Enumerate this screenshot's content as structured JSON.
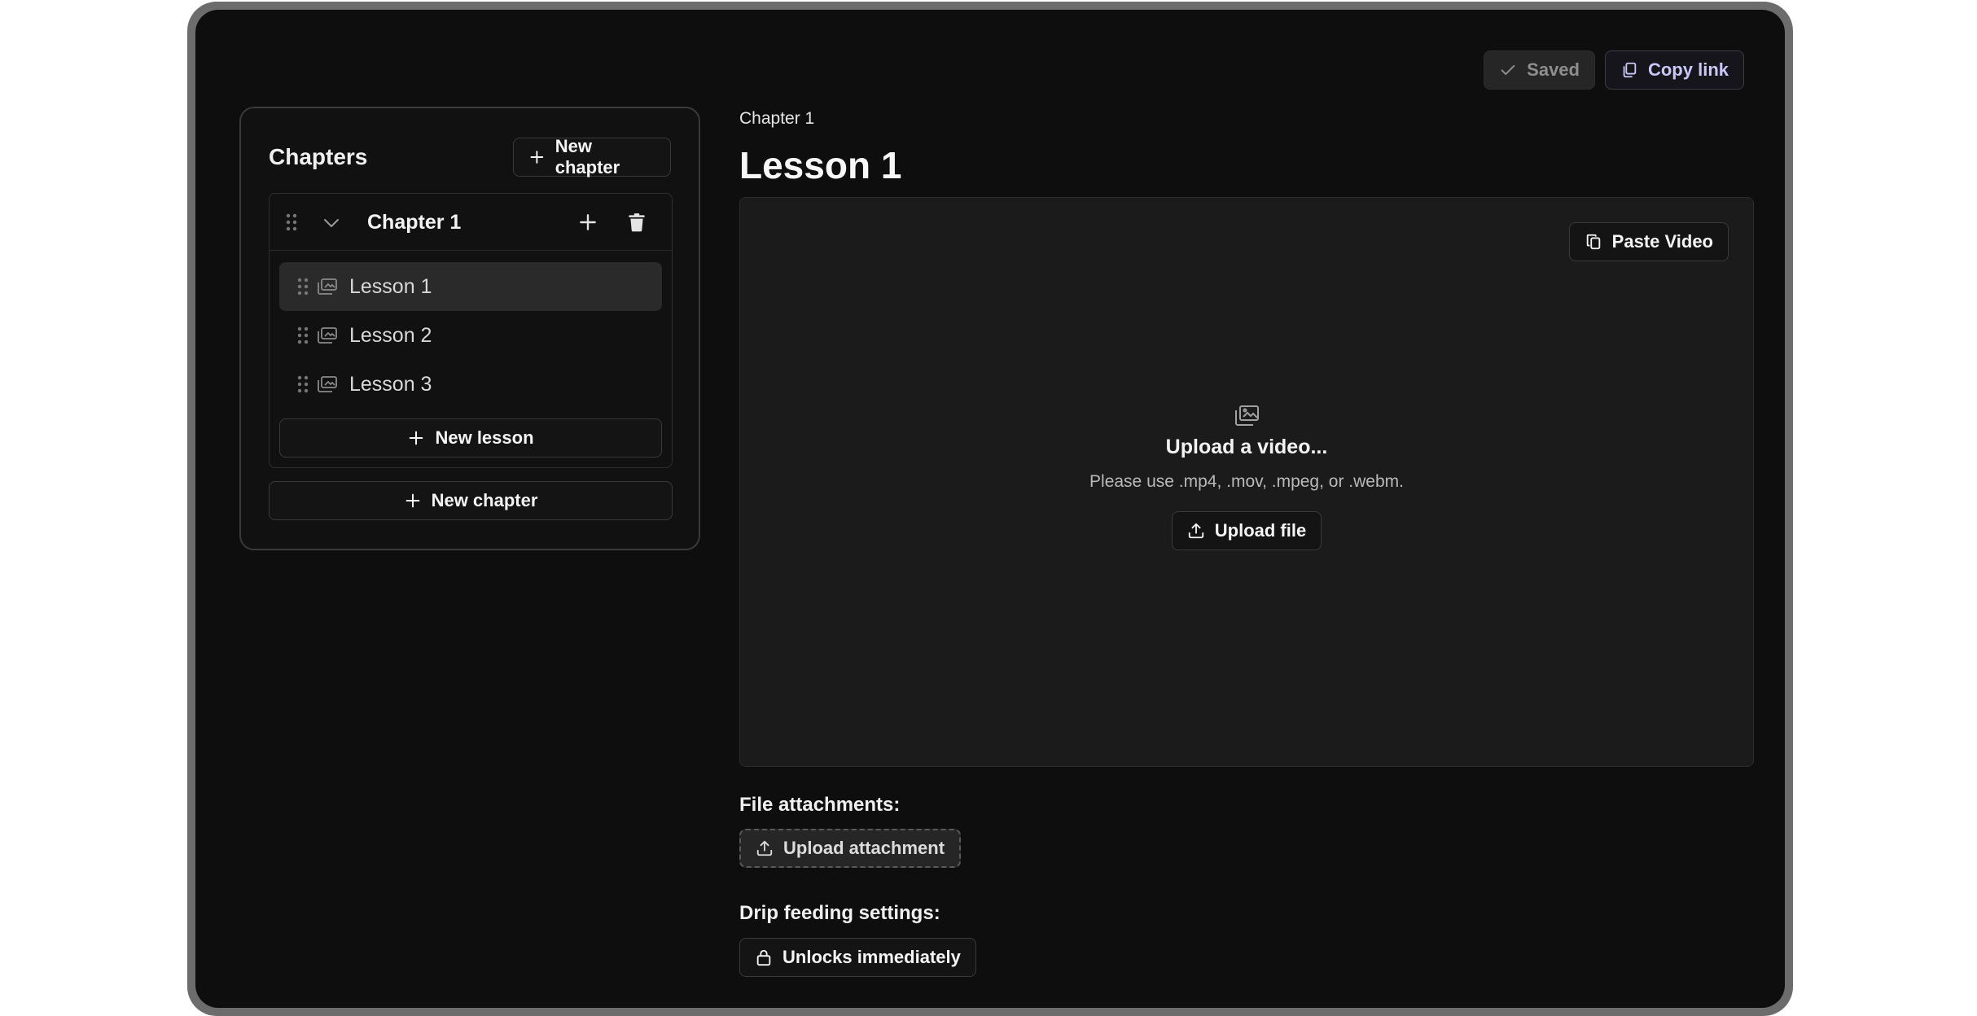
{
  "topbar": {
    "saved_label": "Saved",
    "copy_label": "Copy link"
  },
  "sidebar": {
    "title": "Chapters",
    "new_chapter_label": "New chapter",
    "chapters": [
      {
        "name": "Chapter 1",
        "lessons": [
          {
            "name": "Lesson 1",
            "active": true
          },
          {
            "name": "Lesson 2",
            "active": false
          },
          {
            "name": "Lesson 3",
            "active": false
          }
        ],
        "new_lesson_label": "New lesson"
      }
    ],
    "new_chapter_bottom_label": "New chapter"
  },
  "main": {
    "breadcrumb": "Chapter 1",
    "title": "Lesson 1",
    "upload": {
      "paste_label": "Paste Video",
      "title": "Upload a video...",
      "subtitle": "Please use .mp4, .mov, .mpeg, or .webm.",
      "button_label": "Upload file"
    },
    "attachments": {
      "label": "File attachments:",
      "button_label": "Upload attachment"
    },
    "drip": {
      "label": "Drip feeding settings:",
      "button_label": "Unlocks immediately"
    }
  },
  "colors": {
    "background": "#0e0e0e",
    "surface": "#1b1b1b",
    "accent": "#c9c7f7"
  }
}
